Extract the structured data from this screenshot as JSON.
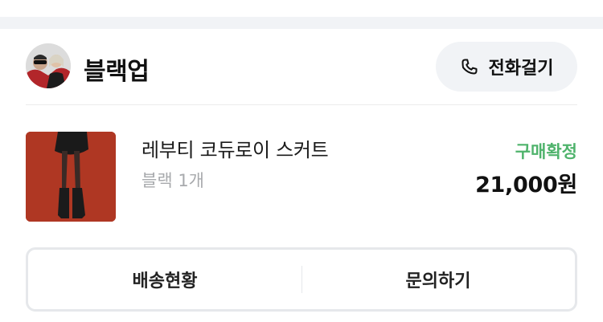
{
  "store": {
    "name": "블랙업",
    "call_label": "전화걸기",
    "call_icon": "phone-icon"
  },
  "order_item": {
    "product_name": "레부티 코듀로이 스커트",
    "option": "블랙 1개",
    "status": "구매확정",
    "price": "21,000원"
  },
  "actions": {
    "shipping_label": "배송현황",
    "inquiry_label": "문의하기"
  },
  "colors": {
    "status_green": "#4fb36c",
    "button_bg": "#f1f3f6",
    "product_bg": "#b23a26"
  }
}
